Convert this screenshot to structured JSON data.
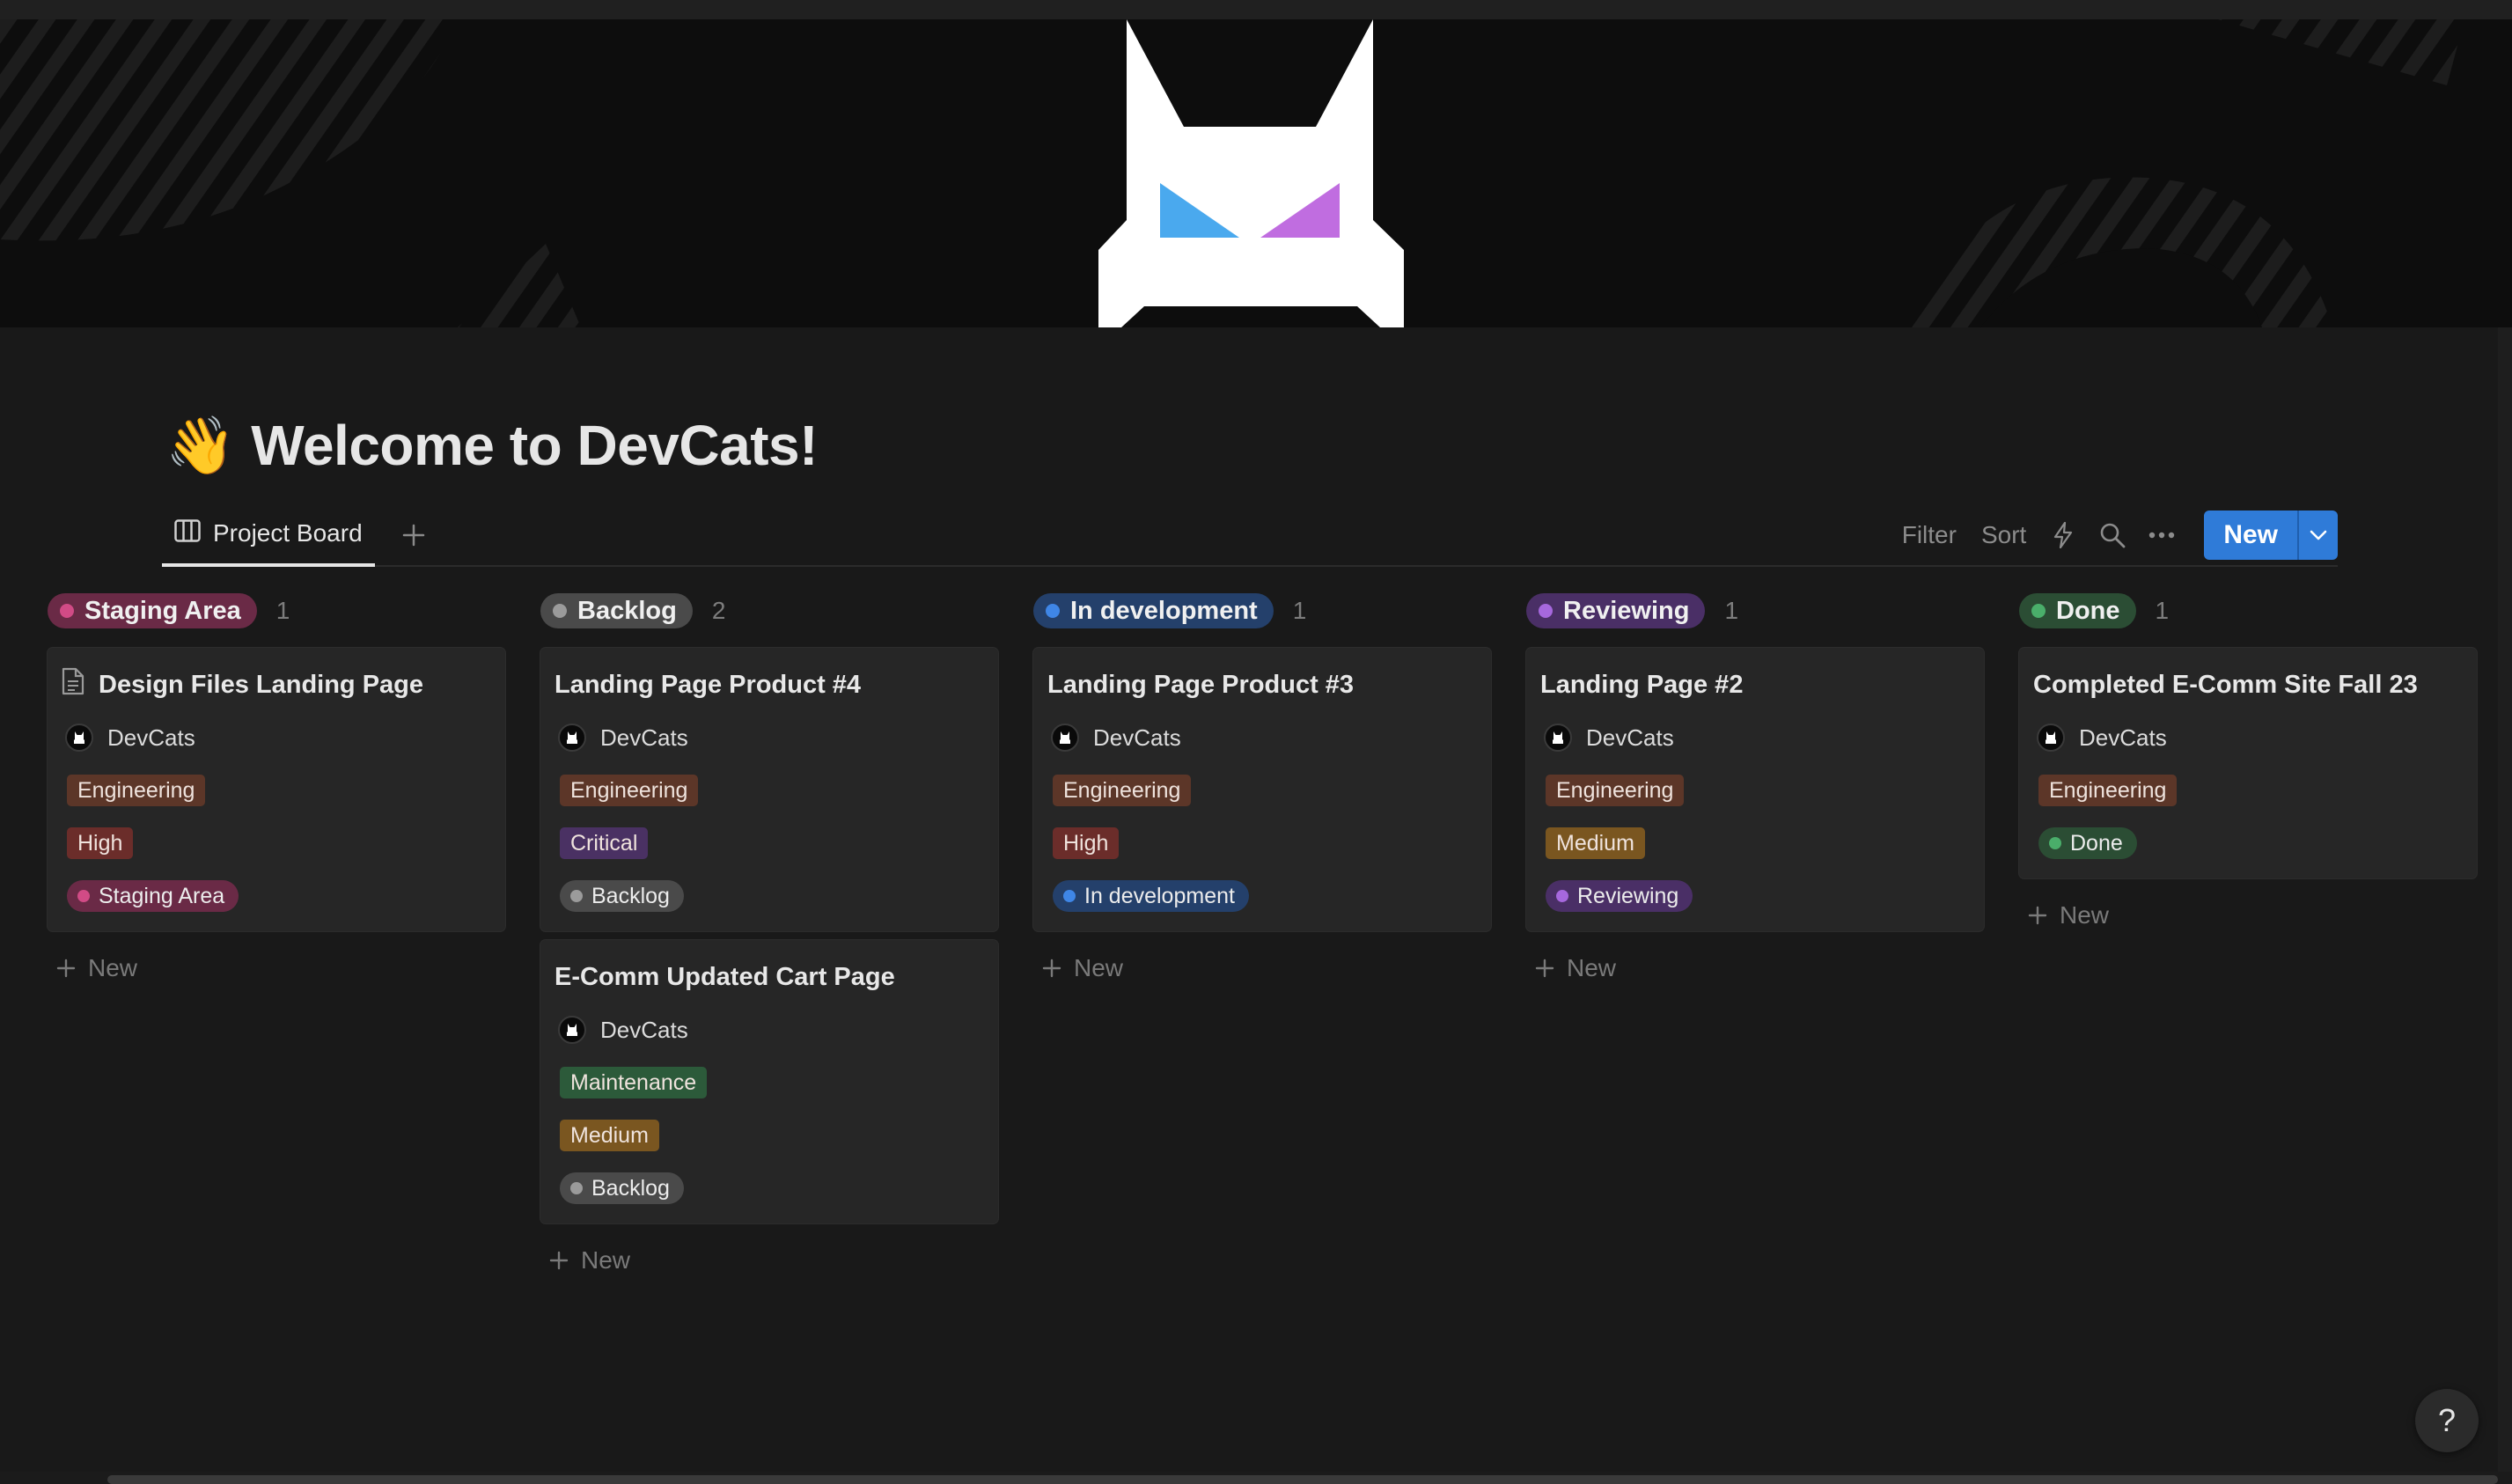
{
  "page": {
    "title": "Welcome to DevCats!",
    "emoji": "👋"
  },
  "views": {
    "tabs": [
      {
        "label": "Project Board"
      }
    ]
  },
  "toolbar": {
    "filter_label": "Filter",
    "sort_label": "Sort",
    "new_label": "New"
  },
  "colors": {
    "background": "#191919",
    "card": "#262626",
    "accent": "#2f7bd8",
    "engineering": "#5c3628",
    "maintenance": "#2c5a3a",
    "high": "#6b2d2a",
    "critical": "#4a3163",
    "medium": "#7a5620"
  },
  "columns": [
    {
      "label": "Staging Area",
      "count": "1",
      "pill": "#6a2a46",
      "dot": "#d14b86",
      "cards": [
        {
          "title": "Design Files Landing Page",
          "has_icon": true,
          "owner": "DevCats",
          "tags": [
            {
              "label": "Engineering",
              "color": "#5c3628"
            },
            {
              "label": "High",
              "color": "#6b2d2a"
            }
          ],
          "status": {
            "label": "Staging Area",
            "bg": "#6a2a46",
            "dot": "#d14b86"
          }
        }
      ],
      "new_label": "New"
    },
    {
      "label": "Backlog",
      "count": "2",
      "pill": "#4a4a4a",
      "dot": "#9b9b9b",
      "cards": [
        {
          "title": "Landing Page Product #4",
          "has_icon": false,
          "owner": "DevCats",
          "tags": [
            {
              "label": "Engineering",
              "color": "#5c3628"
            },
            {
              "label": "Critical",
              "color": "#4a3163"
            }
          ],
          "status": {
            "label": "Backlog",
            "bg": "#4a4a4a",
            "dot": "#9b9b9b"
          }
        },
        {
          "title": "E-Comm Updated Cart Page",
          "has_icon": false,
          "owner": "DevCats",
          "tags": [
            {
              "label": "Maintenance",
              "color": "#2c5a3a"
            },
            {
              "label": "Medium",
              "color": "#7a5620"
            }
          ],
          "status": {
            "label": "Backlog",
            "bg": "#4a4a4a",
            "dot": "#9b9b9b"
          }
        }
      ],
      "new_label": "New"
    },
    {
      "label": "In development",
      "count": "1",
      "pill": "#24406b",
      "dot": "#3f86e6",
      "cards": [
        {
          "title": "Landing Page Product #3",
          "has_icon": false,
          "owner": "DevCats",
          "tags": [
            {
              "label": "Engineering",
              "color": "#5c3628"
            },
            {
              "label": "High",
              "color": "#6b2d2a"
            }
          ],
          "status": {
            "label": "In development",
            "bg": "#24406b",
            "dot": "#3f86e6"
          }
        }
      ],
      "new_label": "New"
    },
    {
      "label": "Reviewing",
      "count": "1",
      "pill": "#4a2f66",
      "dot": "#a668dd",
      "cards": [
        {
          "title": "Landing Page #2",
          "has_icon": false,
          "owner": "DevCats",
          "tags": [
            {
              "label": "Engineering",
              "color": "#5c3628"
            },
            {
              "label": "Medium",
              "color": "#7a5620"
            }
          ],
          "status": {
            "label": "Reviewing",
            "bg": "#4a2f66",
            "dot": "#a668dd"
          }
        }
      ],
      "new_label": "New"
    },
    {
      "label": "Done",
      "count": "1",
      "pill": "#2b4d34",
      "dot": "#4aae6a",
      "cards": [
        {
          "title": "Completed E-Comm Site Fall 23",
          "has_icon": false,
          "owner": "DevCats",
          "tags": [
            {
              "label": "Engineering",
              "color": "#5c3628"
            }
          ],
          "status": {
            "label": "Done",
            "bg": "#2b4d34",
            "dot": "#4aae6a"
          }
        }
      ],
      "new_label": "New"
    }
  ],
  "help_label": "?"
}
